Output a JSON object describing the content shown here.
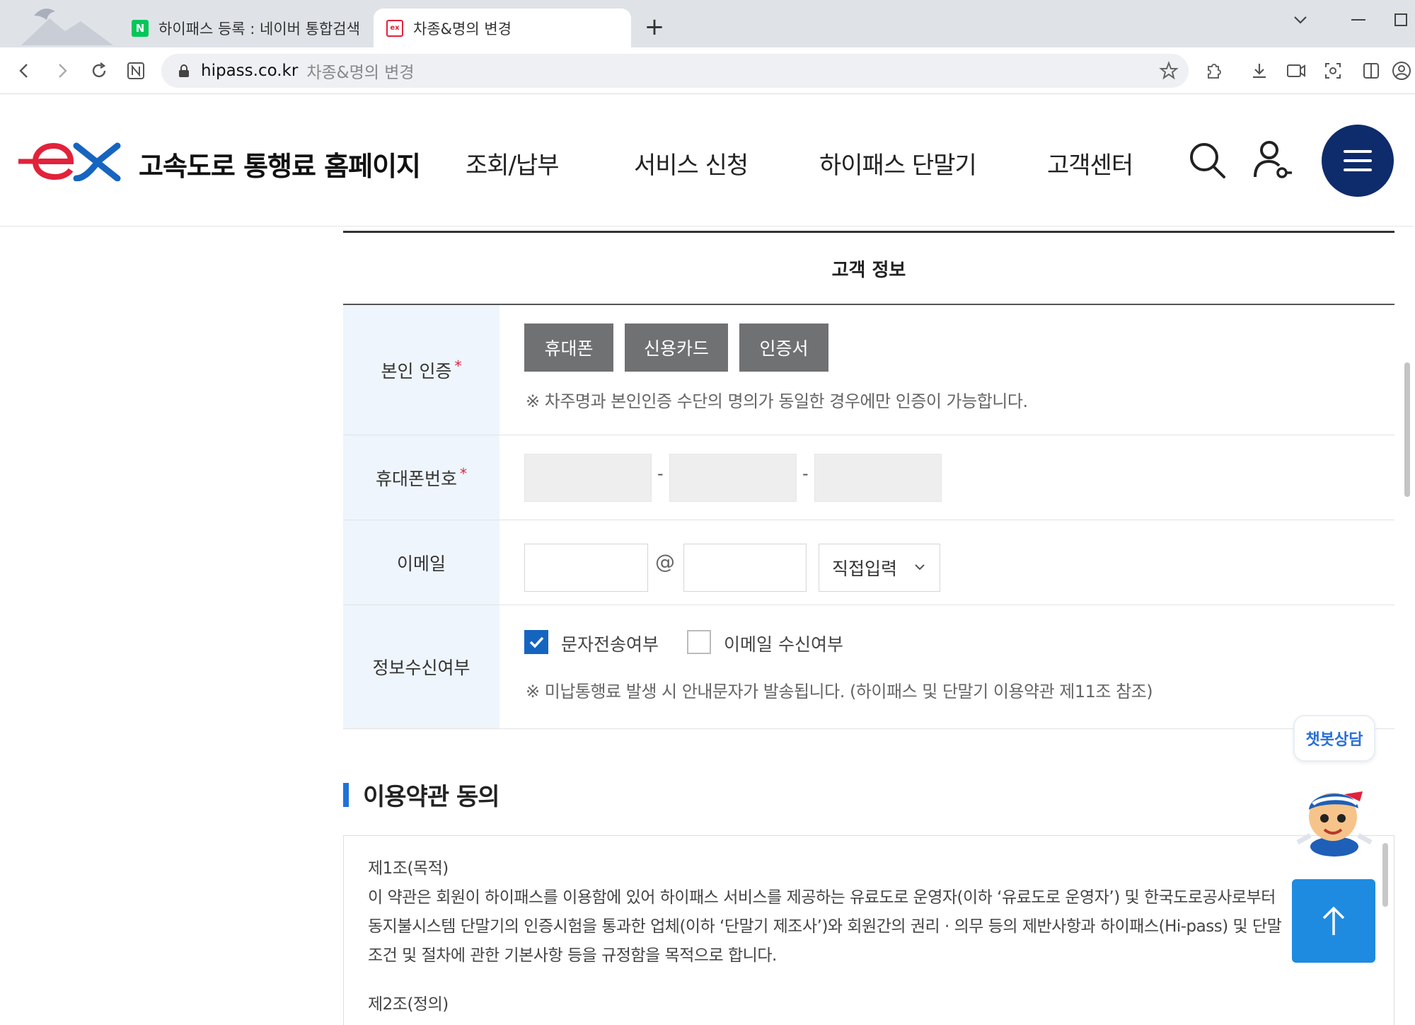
{
  "browser": {
    "tabs": [
      {
        "title": "하이패스 등록 : 네이버 통합검색",
        "favicon": "naver-icon",
        "active": false
      },
      {
        "title": "차종&명의 변경",
        "favicon": "ex-icon",
        "active": true
      }
    ],
    "new_tab_label": "+",
    "address": {
      "domain": "hipass.co.kr",
      "page_title": "차종&명의 변경"
    }
  },
  "site": {
    "title": "고속도로 통행료 홈페이지",
    "nav": [
      "조회/납부",
      "서비스 신청",
      "하이패스 단말기",
      "고객센터"
    ],
    "brand_color": "#0e2c6b",
    "accent_color": "#e2223a"
  },
  "form": {
    "section_title": "고객 정보",
    "required_mark": "*",
    "auth": {
      "label": "본인 인증",
      "buttons": [
        "휴대폰",
        "신용카드",
        "인증서"
      ],
      "note": "※ 차주명과 본인인증 수단의 명의가 동일한 경우에만 인증이 가능합니다."
    },
    "phone": {
      "label": "휴대폰번호",
      "separator": "-"
    },
    "email": {
      "label": "이메일",
      "at": "@",
      "domain_select": "직접입력"
    },
    "consent": {
      "label": "정보수신여부",
      "sms_label": "문자전송여부",
      "sms_checked": true,
      "email_label": "이메일 수신여부",
      "email_checked": false,
      "note": "※ 미납통행료 발생 시 안내문자가 발송됩니다. (하이패스 및 단말기 이용약관 제11조 참조)"
    }
  },
  "terms": {
    "title": "이용약관 동의",
    "lines": [
      "제1조(목적)",
      "이 약관은 회원이 하이패스를 이용함에 있어 하이패스 서비스를 제공하는 유료도로 운영자(이하 ‘유료도로 운영자’) 및 한국도로공사로부터",
      "동지불시스템 단말기의 인증시험을 통과한 업체(이하 ‘단말기 제조사’)와 회원간의 권리 · 의무 등의 제반사항과 하이패스(Hi-pass) 및 단말",
      "조건 및 절차에 관한 기본사항 등을 규정함을 목적으로 합니다."
    ],
    "next_heading": "제2조(정의)"
  },
  "widgets": {
    "chatbot_label": "챗봇상담",
    "top_icon": "arrow-up-icon"
  }
}
